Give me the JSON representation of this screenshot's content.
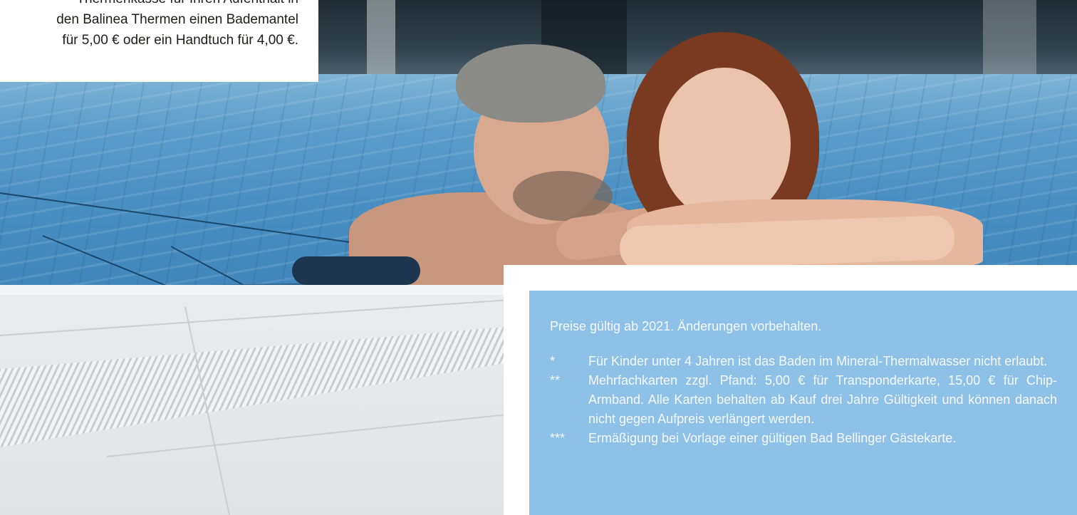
{
  "intro": {
    "lines": [
      "Thermenkasse für Ihren Aufenthalt in",
      "den Balinea Thermen einen Bademantel",
      "für 5,00 € oder ein Handtuch für 4,00 €."
    ]
  },
  "notes": {
    "validity": "Preise gültig ab 2021. Änderungen vorbehalten.",
    "items": [
      {
        "mark": "*",
        "text": "Für Kinder unter 4 Jahren ist das Baden im Mineral-Thermalwasser nicht erlaubt."
      },
      {
        "mark": "**",
        "text": "Mehrfachkarten zzgl. Pfand: 5,00 € für Transponderkarte, 15,00 € für Chip-Armband. Alle Karten behalten ab Kauf drei Jahre Gültigkeit und können danach nicht gegen Aufpreis verlängert werden."
      },
      {
        "mark": "***",
        "text": "Ermäßigung bei Vorlage einer gültigen Bad Bellinger Gästekarte."
      }
    ]
  },
  "colors": {
    "panel": "#8ec1e7",
    "panel_text": "#f4f9fd",
    "water": "#4a8fc2",
    "body_text": "#1d1d1b"
  }
}
